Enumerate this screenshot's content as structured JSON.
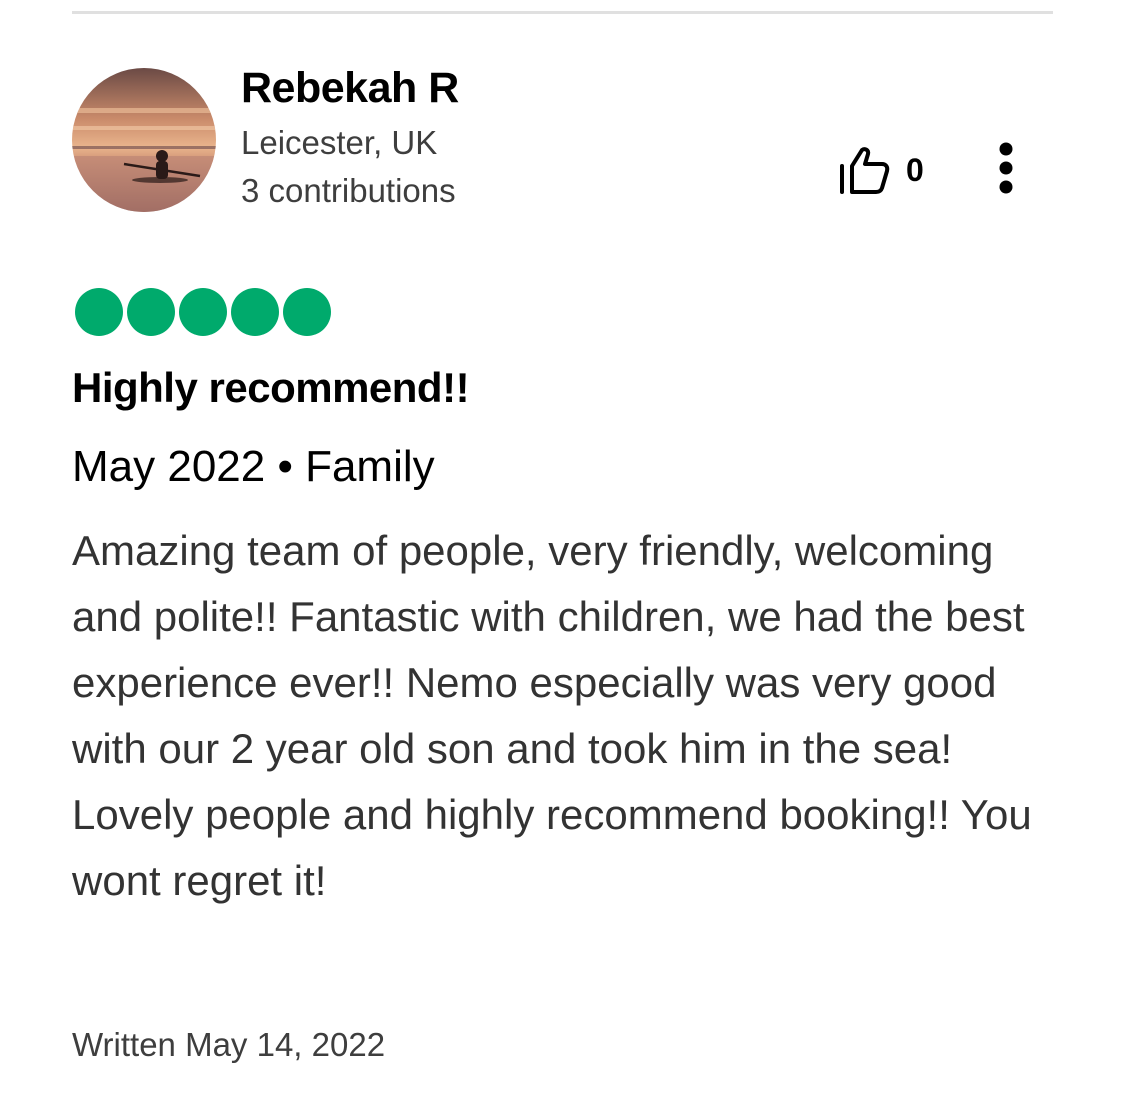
{
  "reviewer": {
    "name": "Rebekah R",
    "location": "Leicester, UK",
    "contributions": "3 contributions"
  },
  "actions": {
    "helpful_count": "0",
    "helpful_icon": "thumbs-up-icon",
    "more_icon": "more-options-icon"
  },
  "review": {
    "rating": 5,
    "max_rating": 5,
    "rating_color": "#00aa6c",
    "title": "Highly recommend!!",
    "meta": "May 2022 • Family",
    "body": "Amazing team of people, very friendly, welcoming and polite!! Fantastic with children, we had the best experience ever!! Nemo especially was very good with our 2 year old son and took him in the sea! Lovely people and highly recommend booking!! You wont regret it!",
    "written": "Written May 14, 2022"
  }
}
